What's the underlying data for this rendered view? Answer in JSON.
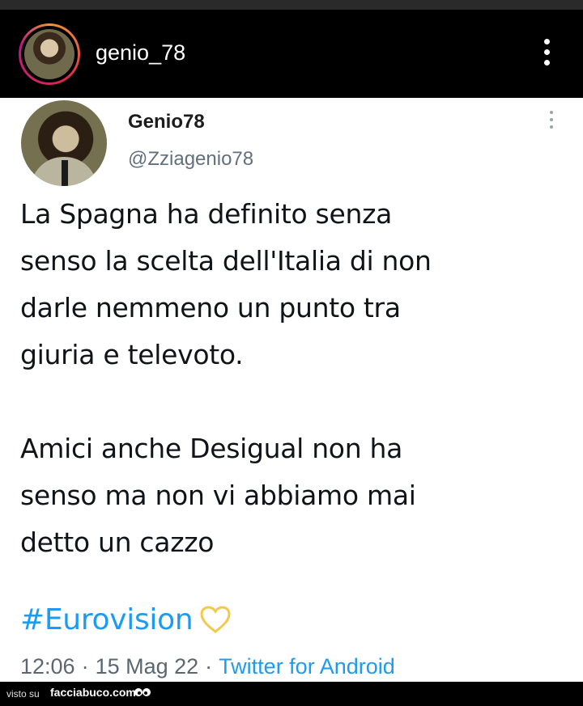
{
  "instagram_header": {
    "username": "genio_78"
  },
  "tweet": {
    "display_name": "Genio78",
    "handle": "@Zziagenio78",
    "text_lines_paragraph1": [
      "La Spagna ha definito senza",
      "senso la scelta dell'Italia di non",
      "darle nemmeno un punto tra",
      "giuria e televoto."
    ],
    "text_lines_paragraph2": [
      "Amici anche Desigual non ha",
      "senso ma non vi abbiamo mai",
      "detto un cazzo"
    ],
    "hashtag": "#Eurovision",
    "heart_color": "#f2c94c",
    "time": "12:06",
    "date": "15 Mag 22",
    "source": "Twitter for Android"
  },
  "footer": {
    "visto_su": "visto su",
    "brand": "facciabuco.com"
  },
  "colors": {
    "link_blue": "#1d9bf0",
    "header_bg": "#000000"
  }
}
